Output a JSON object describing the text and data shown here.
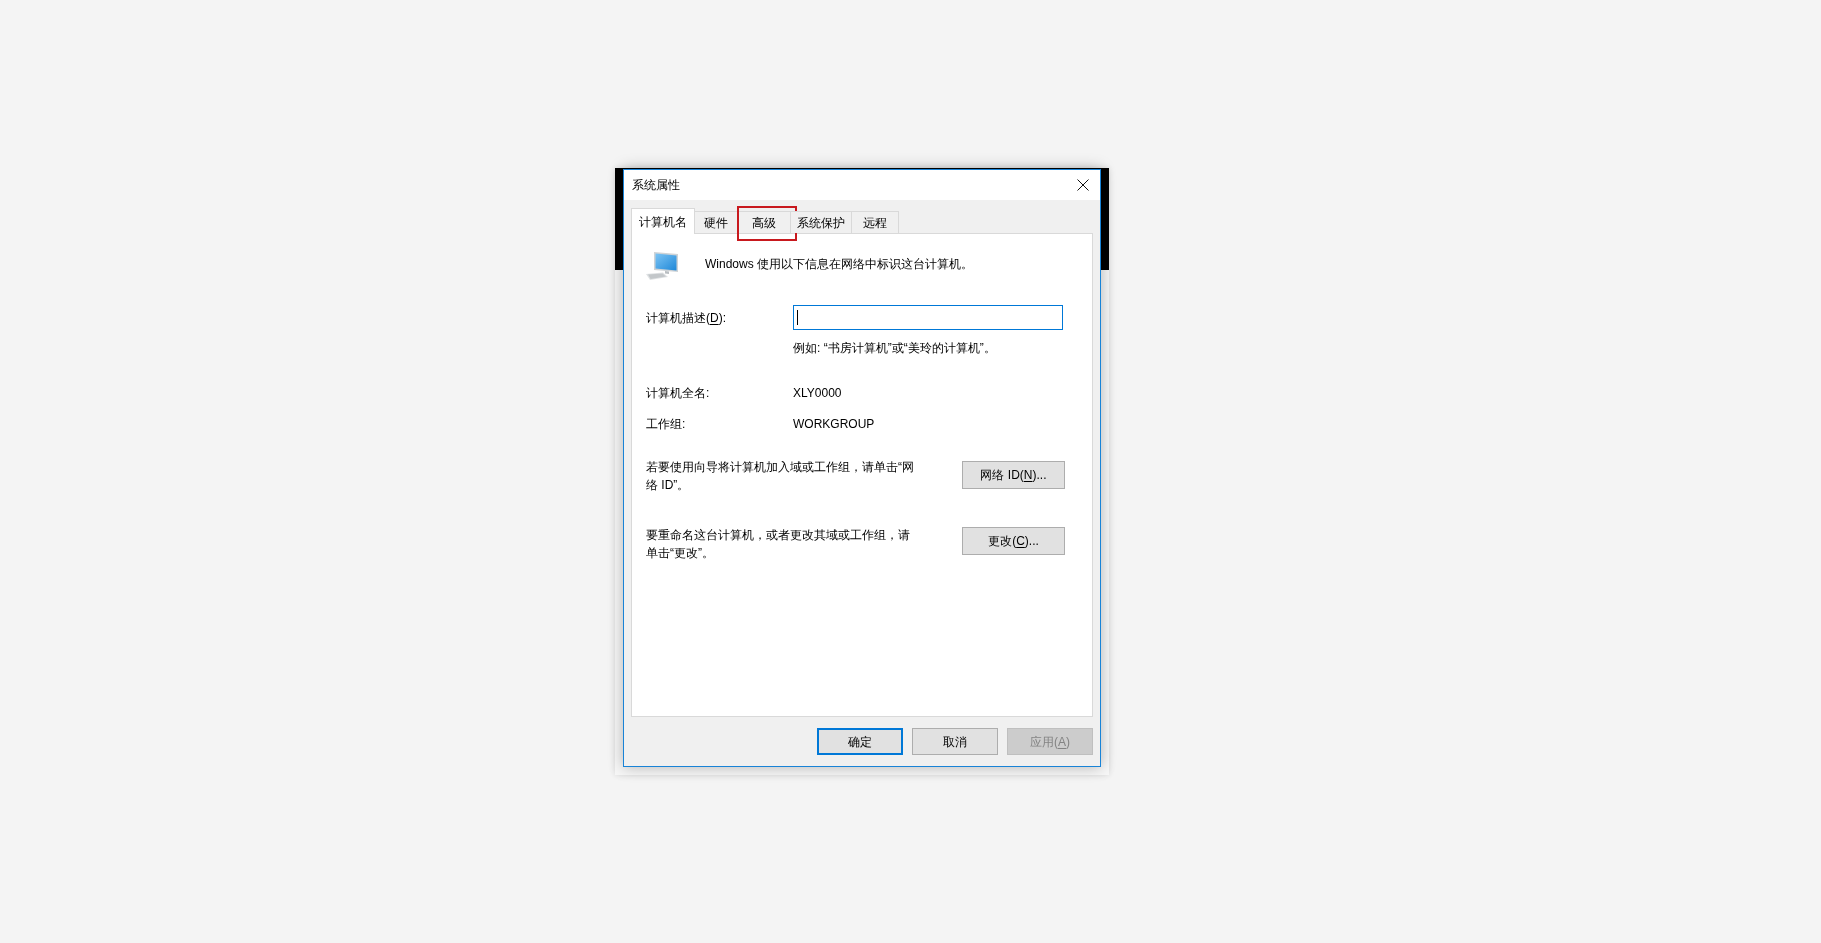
{
  "window": {
    "title": "系统属性"
  },
  "tabs": [
    {
      "label": "计算机名",
      "selected": true,
      "highlighted": false
    },
    {
      "label": "硬件",
      "selected": false,
      "highlighted": false
    },
    {
      "label": "高级",
      "selected": false,
      "highlighted": true
    },
    {
      "label": "系统保护",
      "selected": false,
      "highlighted": false
    },
    {
      "label": "远程",
      "selected": false,
      "highlighted": false
    }
  ],
  "header": {
    "text": "Windows 使用以下信息在网络中标识这台计算机。"
  },
  "description": {
    "label_before": "计算机描述(",
    "access_key": "D",
    "label_after": "):",
    "focused": true,
    "example": "例如: “书房计算机”或“美玲的计算机”。"
  },
  "info_rows": [
    {
      "label": "计算机全名:",
      "value": "XLY0000"
    },
    {
      "label": "工作组:",
      "value": "WORKGROUP"
    }
  ],
  "actions": [
    {
      "text": "若要使用向导将计算机加入域或工作组，请单击“网络 ID”。",
      "button": {
        "label_before": "网络 ID(",
        "access_key": "N",
        "label_after": ")..."
      }
    },
    {
      "text": "要重命名这台计算机，或者更改其域或工作组，请单击“更改”。",
      "button": {
        "label_before": "更改(",
        "access_key": "C",
        "label_after": ")..."
      }
    }
  ],
  "buttons": [
    {
      "label": "确定",
      "default": true,
      "disabled": false
    },
    {
      "label": "取消",
      "default": false,
      "disabled": false
    },
    {
      "label_before": "应用(",
      "access_key": "A",
      "label_after": ")",
      "default": false,
      "disabled": true
    }
  ]
}
